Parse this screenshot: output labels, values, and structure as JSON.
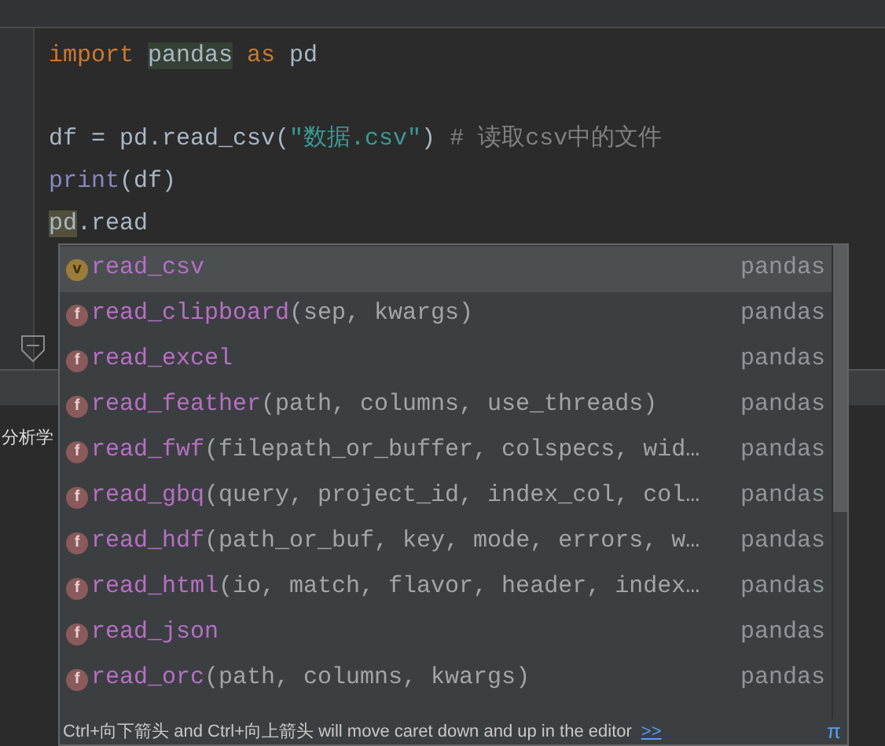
{
  "code_lines": [
    {
      "tokens": [
        {
          "kind": "keyword",
          "text": "import "
        },
        {
          "kind": "highlight",
          "text": "pandas"
        },
        {
          "kind": "keyword",
          "text": " as"
        },
        {
          "kind": "plain",
          "text": " pd"
        }
      ]
    },
    {
      "kind": "blank"
    },
    {
      "tokens": [
        {
          "kind": "plain",
          "text": "df = pd.read_csv("
        },
        {
          "kind": "string",
          "text": "\"数据.csv\""
        },
        {
          "kind": "plain",
          "text": ") "
        },
        {
          "kind": "comment",
          "text": "# 读取csv中的文件"
        }
      ]
    },
    {
      "tokens": [
        {
          "kind": "builtin",
          "text": "print"
        },
        {
          "kind": "plain",
          "text": "(df)"
        }
      ]
    },
    {
      "tokens": [
        {
          "kind": "usage",
          "text": "pd"
        },
        {
          "kind": "plain",
          "text": ".read"
        }
      ]
    }
  ],
  "bottom_panel": {
    "text": "分析学"
  },
  "completion": {
    "items": [
      {
        "icon": "v",
        "kind": "variable",
        "match": "read",
        "rest": "_csv",
        "source": "pandas",
        "selected": true
      },
      {
        "icon": "f",
        "kind": "function",
        "match": "read",
        "rest": "_clipboard",
        "params": "(sep, kwargs)",
        "source": "pandas",
        "selected": false
      },
      {
        "icon": "f",
        "kind": "function",
        "match": "read",
        "rest": "_excel",
        "source": "pandas",
        "selected": false
      },
      {
        "icon": "f",
        "kind": "function",
        "match": "read",
        "rest": "_feather",
        "params": "(path, columns, use_threads)",
        "source": "pandas",
        "selected": false
      },
      {
        "icon": "f",
        "kind": "function",
        "match": "read",
        "rest": "_fwf",
        "params": "(filepath_or_buffer, colspecs, wid…",
        "source": "pandas",
        "selected": false
      },
      {
        "icon": "f",
        "kind": "function",
        "match": "read",
        "rest": "_gbq",
        "params": "(query, project_id, index_col, col…",
        "source": "pandas",
        "selected": false
      },
      {
        "icon": "f",
        "kind": "function",
        "match": "read",
        "rest": "_hdf",
        "params": "(path_or_buf, key, mode, errors, w…",
        "source": "pandas",
        "selected": false
      },
      {
        "icon": "f",
        "kind": "function",
        "match": "read",
        "rest": "_html",
        "params": "(io, match, flavor, header, index…",
        "source": "pandas",
        "selected": false
      },
      {
        "icon": "f",
        "kind": "function",
        "match": "read",
        "rest": "_json",
        "source": "pandas",
        "selected": false
      },
      {
        "icon": "f",
        "kind": "function",
        "match": "read",
        "rest": "_orc",
        "params": "(path, columns, kwargs)",
        "source": "pandas",
        "selected": false
      }
    ],
    "footer": {
      "hint": "Ctrl+向下箭头 and Ctrl+向上箭头 will move caret down and up in the editor",
      "link": ">>",
      "corner": "π"
    }
  }
}
